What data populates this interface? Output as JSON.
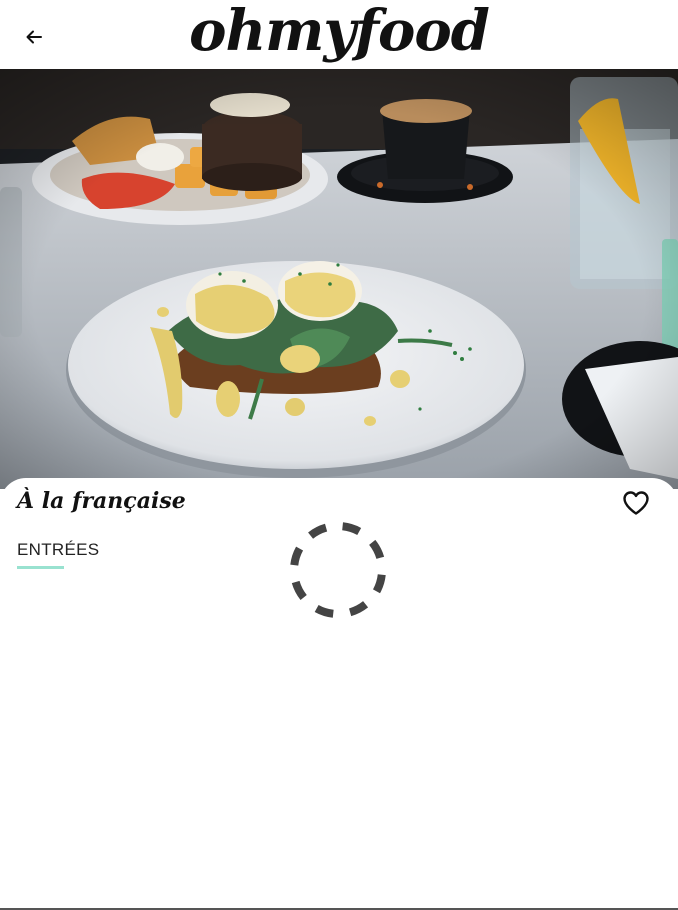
{
  "header": {
    "logo_text": "ohmyfood",
    "back_icon": "arrow-left-icon"
  },
  "hero": {
    "image_subject": "eggs-benedict-on-plate"
  },
  "restaurant": {
    "title": "À la française",
    "favorite_icon": "heart-outline-icon"
  },
  "menu": {
    "section_label": "ENTRÉES"
  },
  "loader": {
    "icon": "loading-spinner-icon"
  },
  "colors": {
    "accent": "#99E2D0",
    "text": "#111111",
    "background": "#ffffff"
  }
}
